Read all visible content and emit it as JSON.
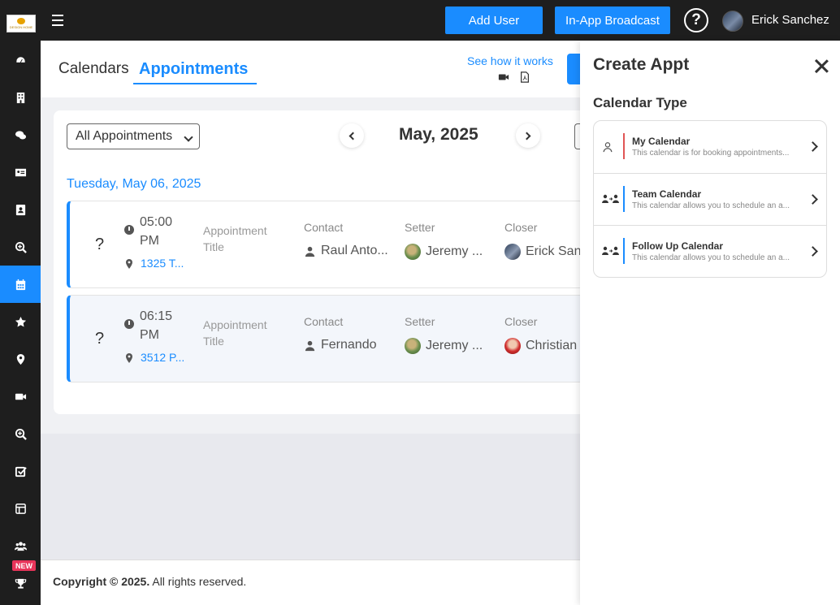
{
  "topbar": {
    "logo_text": "DESIGN HOME",
    "add_user_label": "Add User",
    "broadcast_label": "In-App Broadcast",
    "help_label": "?",
    "user_name": "Erick Sanchez"
  },
  "sidebar": {
    "items": [
      {
        "name": "dashboard-icon"
      },
      {
        "name": "building-icon"
      },
      {
        "name": "chat-icon"
      },
      {
        "name": "id-card-icon"
      },
      {
        "name": "contact-book-icon"
      },
      {
        "name": "search-plus-icon"
      },
      {
        "name": "calendar-icon",
        "active": true
      },
      {
        "name": "star-icon"
      },
      {
        "name": "location-pin-icon"
      },
      {
        "name": "video-camera-icon"
      },
      {
        "name": "search-plus-icon-2"
      },
      {
        "name": "checkbox-icon"
      },
      {
        "name": "layout-icon"
      },
      {
        "name": "users-icon"
      },
      {
        "name": "trophy-icon"
      }
    ],
    "new_badge": "NEW"
  },
  "header": {
    "tab_calendars": "Calendars",
    "tab_appointments": "Appointments",
    "see_how": "See how it works"
  },
  "content": {
    "filter_value": "All Appointments",
    "month": "May, 2025",
    "date_heading": "Tuesday, May 06, 2025",
    "appointments": [
      {
        "icon": "?",
        "time": "05:00 PM",
        "address": "1325 T...",
        "title_label": "Appointment Title",
        "contact_label": "Contact",
        "contact": "Raul Anto...",
        "setter_label": "Setter",
        "setter": "Jeremy ...",
        "closer_label": "Closer",
        "closer": "Erick Sanchez"
      },
      {
        "icon": "?",
        "time": "06:15 PM",
        "address": "3512 P...",
        "title_label": "Appointment Title",
        "contact_label": "Contact",
        "contact": "Fernando",
        "setter_label": "Setter",
        "setter": "Jeremy ...",
        "closer_label": "Closer",
        "closer": "Christian"
      }
    ]
  },
  "footer": {
    "copyright": "Copyright © 2025.",
    "rights": "All rights reserved."
  },
  "panel": {
    "title": "Create Appt",
    "subtitle": "Calendar Type",
    "types": [
      {
        "name": "My Calendar",
        "description": "This calendar is for booking appointments...",
        "color": "#e05555"
      },
      {
        "name": "Team Calendar",
        "description": "This calendar allows you to schedule an a...",
        "color": "#1a8cff"
      },
      {
        "name": "Follow Up Calendar",
        "description": "This calendar allows you to schedule an a...",
        "color": "#1a8cff"
      }
    ]
  },
  "colors": {
    "accent": "#1a8cff",
    "topbar": "#1e1e1e",
    "new_badge": "#e8345a"
  }
}
